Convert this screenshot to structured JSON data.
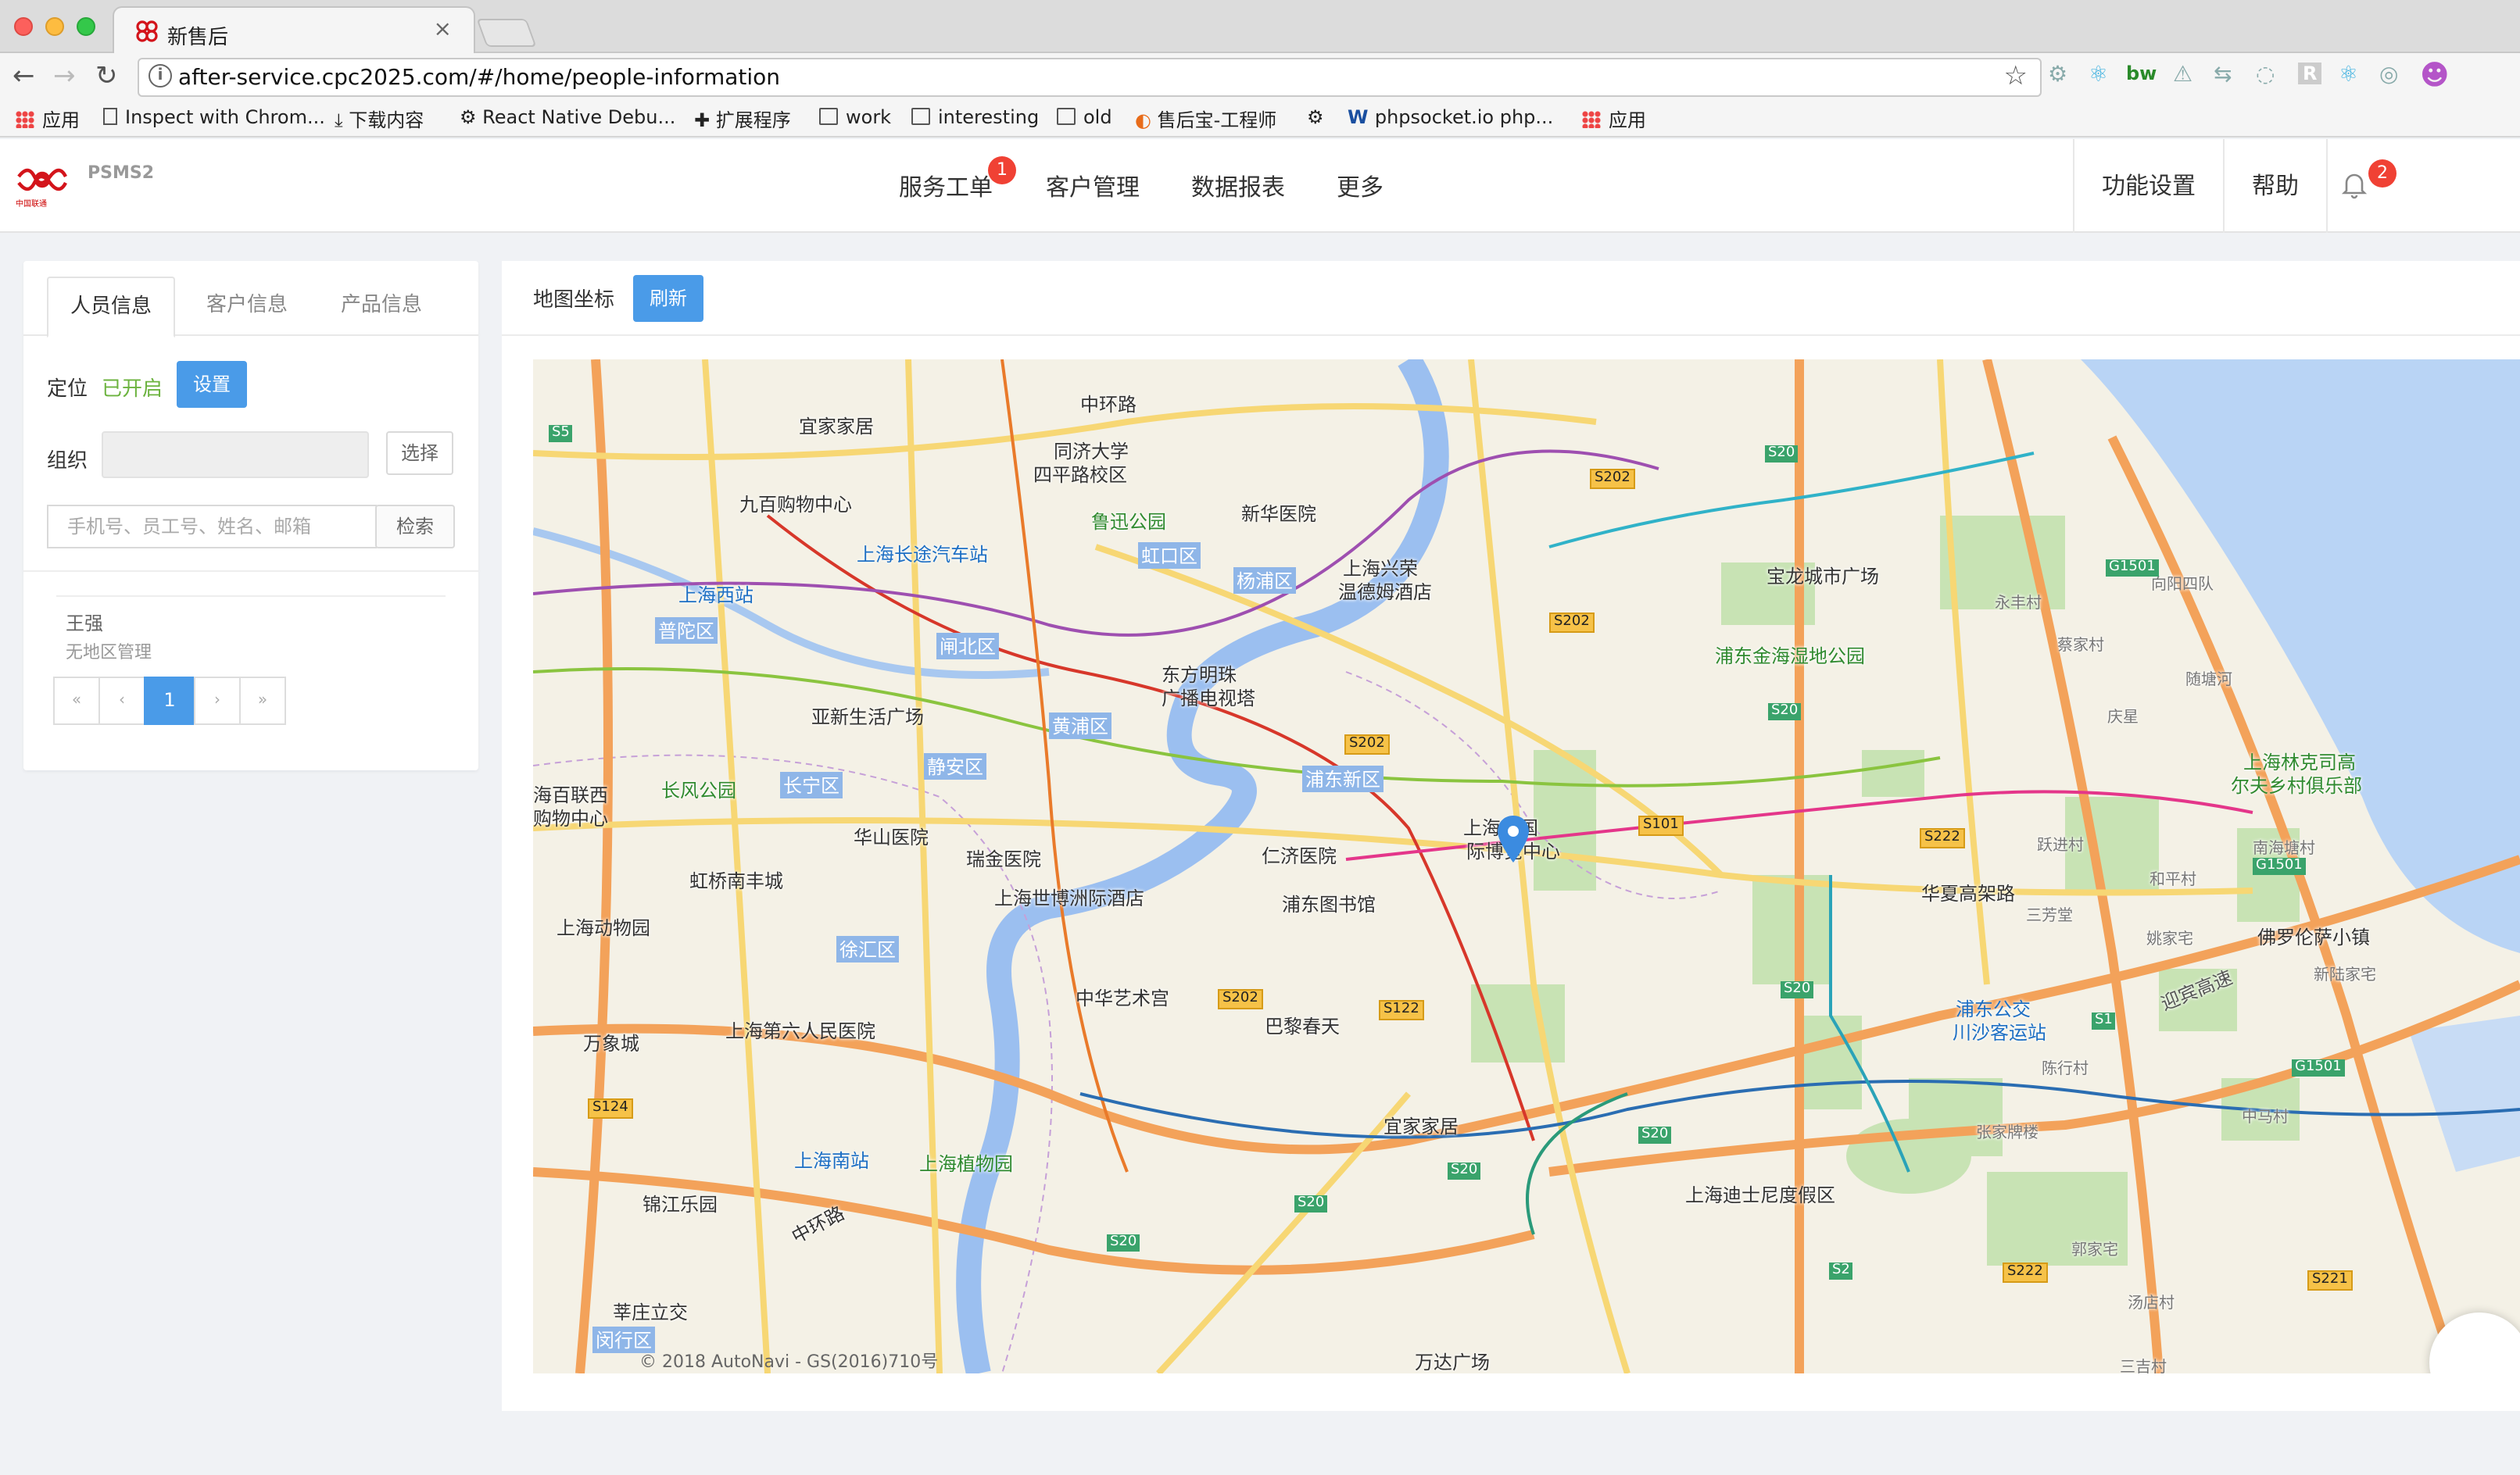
{
  "browser": {
    "tab_title": "新售后",
    "tab_close": "×",
    "url": "after-service.cpc2025.com/#/home/people-information",
    "bookmarks": [
      "应用",
      "Inspect with Chrom...",
      "下载内容",
      "React Native Debu...",
      "扩展程序",
      "work",
      "interesting",
      "old",
      "售后宝-工程师",
      "phpsocket.io php...",
      "应用"
    ]
  },
  "header": {
    "app_name": "PSMS2",
    "logo_text": "中国联通",
    "menu": [
      {
        "label": "服务工单",
        "badge": "1"
      },
      {
        "label": "客户管理"
      },
      {
        "label": "数据报表"
      },
      {
        "label": "更多"
      }
    ],
    "settings_label": "功能设置",
    "help_label": "帮助",
    "notif_badge": "2",
    "accent": "#4a9be8",
    "badge_color": "#f04134"
  },
  "left_panel": {
    "tabs": [
      "人员信息",
      "客户信息",
      "产品信息"
    ],
    "active_tab": 0,
    "location_label": "定位",
    "location_status": "已开启",
    "location_status_color": "#6cb33f",
    "set_button": "设置",
    "org_label": "组织",
    "org_value": "",
    "select_button": "选择",
    "search_placeholder": "手机号、员工号、姓名、邮箱",
    "search_button": "检索",
    "person": {
      "name": "王强",
      "region": "无地区管理"
    },
    "pager": {
      "first": "«",
      "prev": "‹",
      "current": "1",
      "next": "›",
      "last": "»"
    }
  },
  "map_panel": {
    "title": "地图坐标",
    "refresh_button": "刷新",
    "copyright": "© 2018 AutoNavi - GS(2016)710号",
    "labels": [
      "宜家家居",
      "中环路",
      "同济大学",
      "四平路校区",
      "九百购物中心",
      "鲁迅公园",
      "新华医院",
      "上海长途汽车站",
      "上海西站",
      "虹口区",
      "上海兴荣",
      "温德姆酒店",
      "杨浦区",
      "宝龙城市广场",
      "永丰村",
      "向阳四队",
      "普陀区",
      "闸北区",
      "东方明珠",
      "广播电视塔",
      "浦东金海湿地公园",
      "蔡家村",
      "随塘河",
      "亚新生活广场",
      "黄浦区",
      "庆星",
      "长风公园",
      "长宁区",
      "静安区",
      "浦东新区",
      "上海林克司高",
      "尔夫乡村俱乐部",
      "海百联西",
      "购物中心",
      "华山医院",
      "瑞金医院",
      "仁济医院",
      "上海新国",
      "际博览中心",
      "跃进村",
      "南海塘村",
      "虹桥南丰城",
      "上海世博洲际酒店",
      "浦东图书馆",
      "华夏高架路",
      "三芳堂",
      "和平村",
      "上海动物园",
      "徐汇区",
      "姚家宅",
      "佛罗伦萨小镇",
      "中华艺术宫",
      "浦东公交",
      "川沙客运站",
      "新陆家宅",
      "万象城",
      "上海第六人民医院",
      "巴黎春天",
      "迎宾高速",
      "陈行村",
      "宜家家居",
      "上海南站",
      "上海植物园",
      "张家牌楼",
      "中马村",
      "锦江乐园",
      "中环路",
      "上海迪士尼度假区",
      "郭家宅",
      "莘庄立交",
      "闵行区",
      "万达广场",
      "汤店村",
      "三吉村"
    ],
    "highways": [
      "S5",
      "S20",
      "S202",
      "S202",
      "S202",
      "G1501",
      "S101",
      "S222",
      "G1501",
      "S20",
      "S20",
      "S202",
      "S122",
      "S124",
      "S20",
      "S20",
      "S20",
      "S20",
      "S2",
      "S222",
      "S221",
      "G1501",
      "S1"
    ]
  }
}
